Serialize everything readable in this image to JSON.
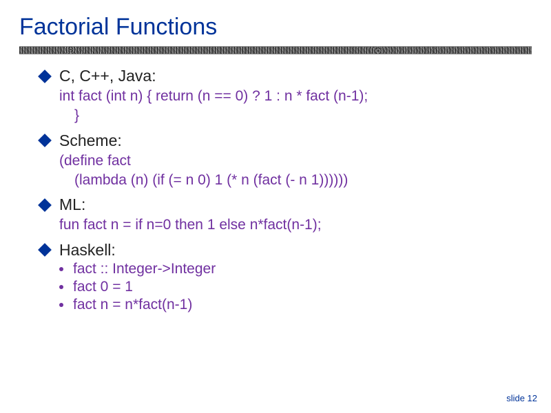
{
  "title": "Factorial Functions",
  "sections": [
    {
      "name": "C, C++, Java:",
      "code_lines": [
        "int fact (int n)  { return (n == 0) ? 1 : n * fact (n-1);",
        "}"
      ]
    },
    {
      "name": "Scheme:",
      "code_lines": [
        "(define fact",
        "(lambda (n)  (if (= n 0) 1 (* n (fact (- n 1))))))"
      ]
    },
    {
      "name": "ML:",
      "code_lines": [
        "fun fact n = if n=0 then 1 else n*fact(n-1);"
      ]
    }
  ],
  "haskell": {
    "name": "Haskell:",
    "items": [
      "fact :: Integer->Integer",
      "fact 0 = 1",
      "fact n = n*fact(n-1)"
    ]
  },
  "footer": "slide 12"
}
